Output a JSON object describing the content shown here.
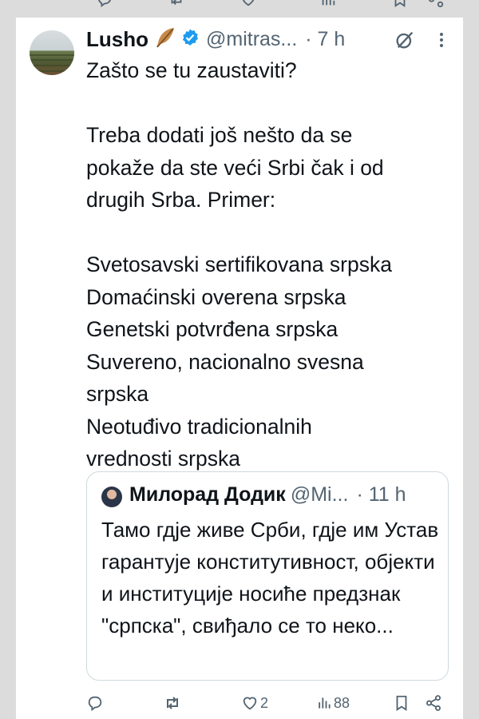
{
  "tweet": {
    "display_name": "Lusho",
    "name_emoji": "🪶",
    "handle": "@mitras...",
    "time": "· 7 h",
    "body": "Zašto se tu zaustaviti?\n\nTreba dodati još nešto da se\npokaže da ste veći Srbi čak i od\ndrugih Srba. Primer:\n\nSvetosavski sertifikovana srpska\nDomaćinski overena srpska\nGenetski potvrđena srpska\nSuvereno, nacionalno svesna\nsrpska\nNeotuđivo tradicionalnih\nvrednosti srpska"
  },
  "quoted": {
    "display_name": "Милорад Додик",
    "handle": "@Mi...",
    "time": "· 11 h",
    "body": "Тамо гдје живе Срби, гдје им Устав гарантује конститутивност, објекти и институције носиће предзнак \"српска\", свиђало се то неко..."
  },
  "actions": {
    "reply_count": "",
    "repost_count": "",
    "like_count": "2",
    "views_count": "88"
  },
  "colors": {
    "text": "#0f1419",
    "secondary": "#536471",
    "verified": "#1d9bf0",
    "border": "#cfd9de"
  },
  "icons": [
    "reply-icon",
    "repost-icon",
    "like-icon",
    "views-icon",
    "bookmark-icon",
    "share-icon",
    "verified-icon",
    "grok-icon",
    "more-icon"
  ]
}
